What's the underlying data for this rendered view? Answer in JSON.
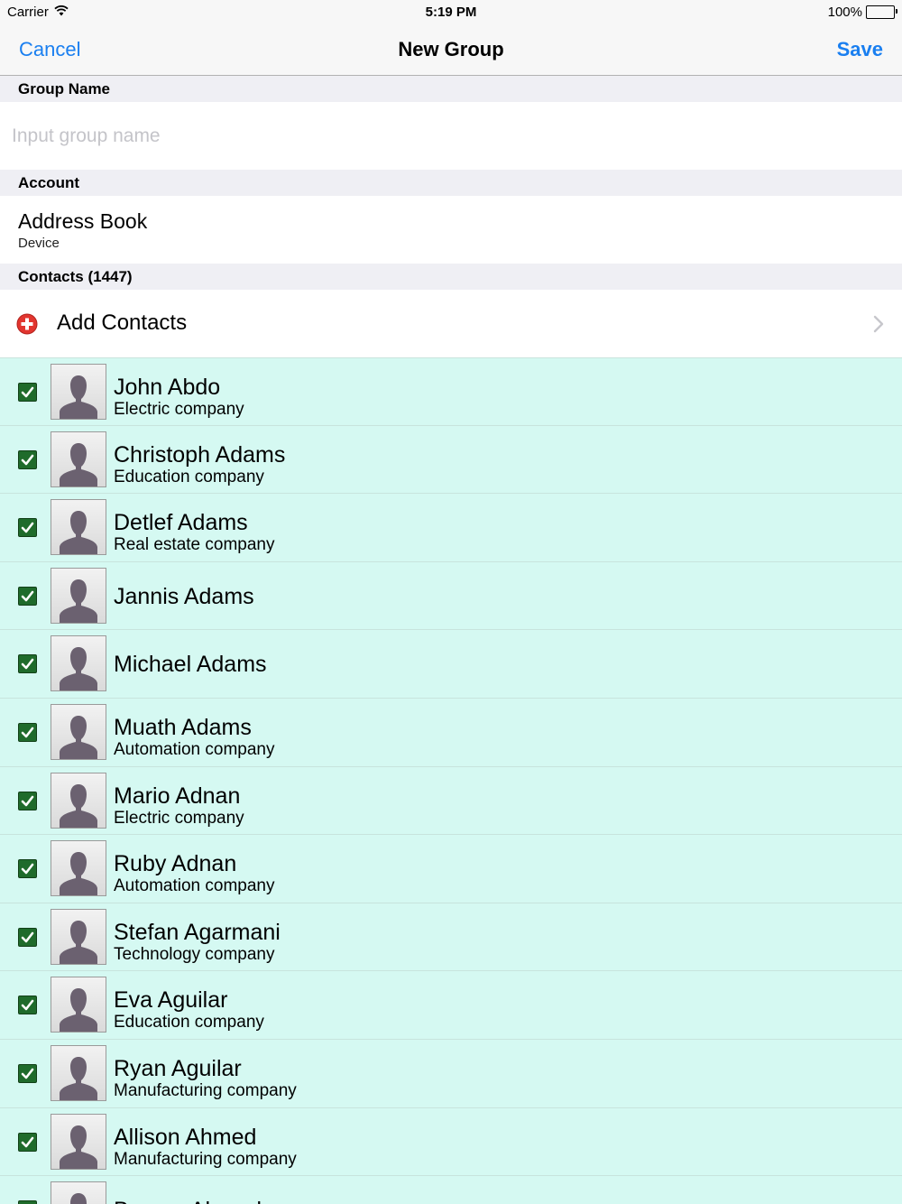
{
  "status_bar": {
    "carrier": "Carrier",
    "wifi_icon": "wifi-icon",
    "time": "5:19 PM",
    "battery_percent": "100%",
    "battery_level": 1.0,
    "battery_icon": "battery-icon"
  },
  "nav": {
    "cancel_label": "Cancel",
    "title": "New Group",
    "save_label": "Save",
    "accent_color": "#1a7ff0"
  },
  "group_name": {
    "header": "Group Name",
    "value": "",
    "placeholder": "Input group name"
  },
  "account": {
    "header": "Account",
    "title": "Address Book",
    "subtitle": "Device"
  },
  "contacts": {
    "header": "Contacts (1447)",
    "add_label": "Add Contacts",
    "add_icon": "plus-circle-icon",
    "add_icon_color": "#e2352f",
    "chevron_icon": "chevron-right-icon",
    "list_background": "#d5f9f2",
    "checkbox_color": "#1f6b2b",
    "items": [
      {
        "name": "John Abdo",
        "company": "Electric company",
        "checked": true
      },
      {
        "name": "Christoph Adams",
        "company": "Education company",
        "checked": true
      },
      {
        "name": "Detlef Adams",
        "company": "Real estate company",
        "checked": true
      },
      {
        "name": "Jannis Adams",
        "company": "",
        "checked": true
      },
      {
        "name": "Michael Adams",
        "company": "",
        "checked": true
      },
      {
        "name": "Muath Adams",
        "company": "Automation company",
        "checked": true
      },
      {
        "name": "Mario Adnan",
        "company": "Electric company",
        "checked": true
      },
      {
        "name": "Ruby Adnan",
        "company": "Automation company",
        "checked": true
      },
      {
        "name": "Stefan Agarmani",
        "company": "Technology company",
        "checked": true
      },
      {
        "name": "Eva Aguilar",
        "company": "Education company",
        "checked": true
      },
      {
        "name": "Ryan Aguilar",
        "company": "Manufacturing company",
        "checked": true
      },
      {
        "name": "Allison Ahmed",
        "company": "Manufacturing company",
        "checked": true
      },
      {
        "name": "Barnes Ahmed",
        "company": "",
        "checked": true
      }
    ]
  }
}
